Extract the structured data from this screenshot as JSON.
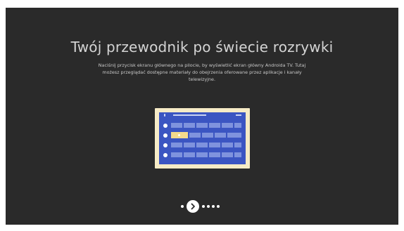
{
  "title": "Twój przewodnik po świecie rozrywki",
  "description": "Naciśnij przycisk ekranu głównego na pilocie, by wyświetlić ekran główny Androida TV. Tutaj możesz przeglądać dostępne materiały do obejrzenia oferowane przez aplikacje i kanały telewizyjne.",
  "illustration": {
    "icon": "tv-home-screen-illustration",
    "colors": {
      "frame": "#f6ebc6",
      "screen": "#3b55c2",
      "tile": "#7f93de",
      "selected_tile": "#f4d98b"
    }
  },
  "pagination": {
    "current_page": 2,
    "total_pages": 6,
    "next_icon": "chevron-right-icon"
  },
  "colors": {
    "background": "#2a2a2a",
    "text": "#d4d4d4"
  }
}
